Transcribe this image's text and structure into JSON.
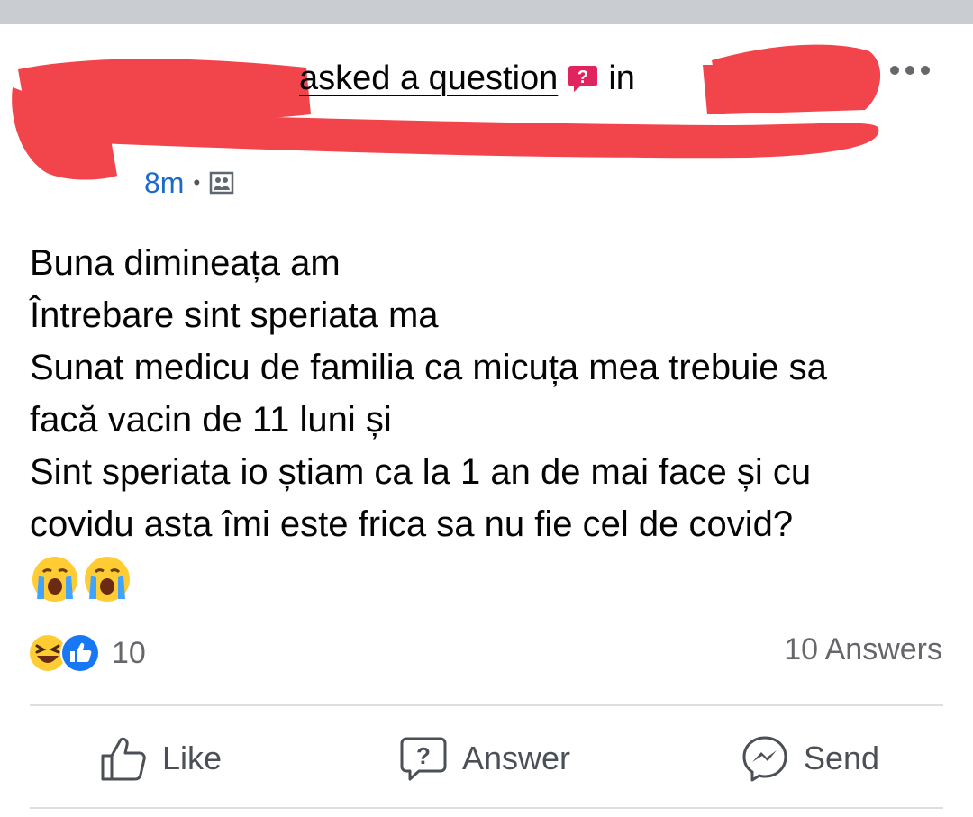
{
  "header": {
    "action_text": "asked a question",
    "in_text": "in",
    "time": "8m",
    "separator": "•",
    "icons": {
      "question": "question-badge-icon",
      "privacy": "photo-group-icon",
      "more": "more-icon"
    },
    "redaction_color": "#f2444b"
  },
  "post": {
    "lines": [
      "Buna dimineața am",
      "Întrebare sint speriata ma",
      "Sunat medicu de familia ca micuța mea trebuie sa",
      "facă vacin de 11 luni și",
      "Sint speriata io știam ca la 1 an de mai face și cu",
      "covidu asta îmi este frica sa nu fie cel de covid?"
    ],
    "emojis": [
      "crying-face-icon",
      "crying-face-icon"
    ]
  },
  "reactions": {
    "icons": [
      "haha-reaction-icon",
      "like-reaction-icon"
    ],
    "count": "10",
    "answers": "10 Answers"
  },
  "actions": {
    "like": "Like",
    "answer": "Answer",
    "send": "Send"
  },
  "colors": {
    "link_blue": "#1b6ac9",
    "question_pink": "#e0245e",
    "like_blue": "#1877f2",
    "secondary_text": "#65676b"
  }
}
